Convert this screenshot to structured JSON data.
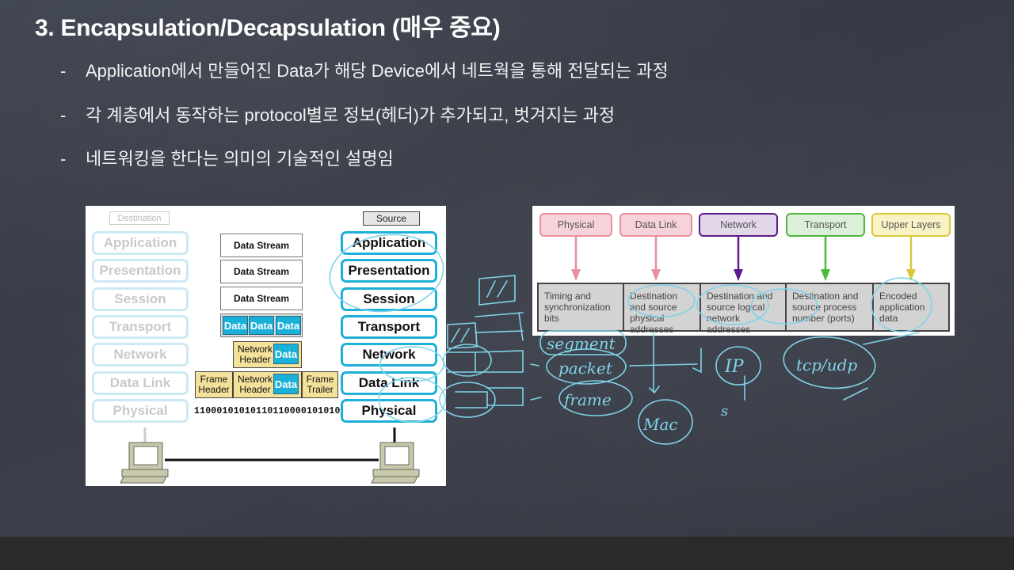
{
  "slide": {
    "title": "3. Encapsulation/Decapsulation (매우 중요)",
    "bullets": [
      {
        "marker": "-",
        "text": "Application에서 만들어진 Data가 해당 Device에서 네트웍을 통해 전달되는 과정"
      },
      {
        "marker": "-",
        "text": "각 계층에서 동작하는 protocol별로 정보(헤더)가 추가되고, 벗겨지는 과정"
      },
      {
        "marker": "-",
        "text": "네트워킹을 한다는 의미의 기술적인 설명임"
      }
    ]
  },
  "osi_diagram": {
    "destination_label": "Destination",
    "source_label": "Source",
    "layers": [
      "Application",
      "Presentation",
      "Session",
      "Transport",
      "Network",
      "Data Link",
      "Physical"
    ],
    "pdus": {
      "data_stream": [
        "Data Stream",
        "Data Stream",
        "Data Stream"
      ],
      "segments": [
        "Data",
        "Data",
        "Data"
      ],
      "packet": {
        "header": "Network Header",
        "data": "Data"
      },
      "frame": {
        "header": "Frame Header",
        "network_header": "Network Header",
        "data": "Data",
        "trailer": "Frame Trailer"
      },
      "bits": "11000101010110110000101010"
    },
    "colors": {
      "source_border": "#1eb0d8",
      "destination_border": "#cde9f3",
      "data_fill": "#1ab0d8",
      "header_fill": "#f4e19a"
    }
  },
  "header_diagram": {
    "columns": [
      {
        "label": "Physical",
        "desc": "Timing and synchronization bits",
        "color": "#e8909e",
        "fill": "#f6d3d8"
      },
      {
        "label": "Data Link",
        "desc": "Destination and source physical addresses",
        "color": "#e8909e",
        "fill": "#f6d3d8"
      },
      {
        "label": "Network",
        "desc": "Destination and source logical network addresses",
        "color": "#5e1a8c",
        "fill": "#e3d7ea"
      },
      {
        "label": "Transport",
        "desc": "Destination and source process number (ports)",
        "color": "#4db83c",
        "fill": "#dcefd8"
      },
      {
        "label": "Upper Layers",
        "desc": "Encoded application data",
        "color": "#d9c93c",
        "fill": "#f8f2c4"
      }
    ]
  },
  "annotations": {
    "handwritten": [
      "segment",
      "packet",
      "frame",
      "Mac",
      "IP",
      "tcp/udp",
      "s"
    ],
    "ink_color": "#7fd3e8"
  }
}
